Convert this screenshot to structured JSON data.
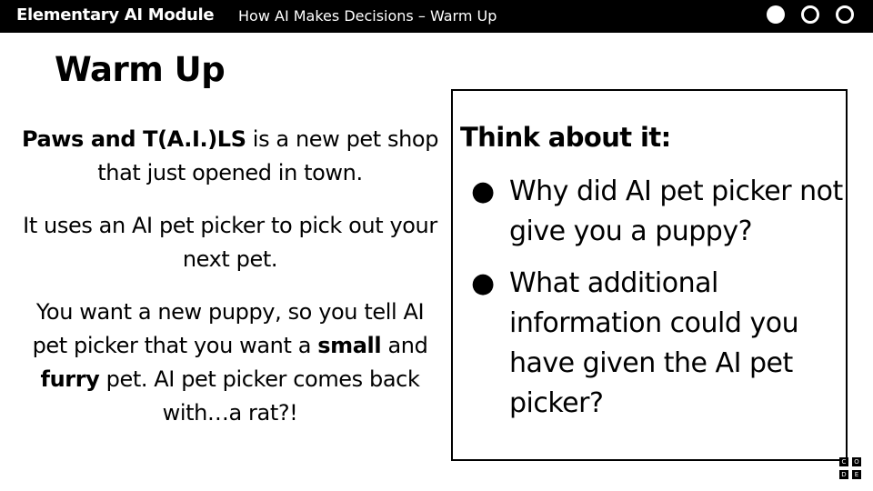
{
  "header": {
    "module_title": "Elementary AI Module",
    "lesson_title": "How AI Makes Decisions – Warm Up",
    "progress_dots": [
      "filled",
      "empty",
      "empty"
    ]
  },
  "slide": {
    "heading": "Warm Up",
    "paragraphs": {
      "p1_bold": "Paws and T(A.I.)LS",
      "p1_rest": " is a new pet shop that just opened in town.",
      "p2": "It uses an AI pet picker to pick out your next pet.",
      "p3_a": "You want a new puppy, so you tell AI pet picker that you want a ",
      "p3_bold1": "small",
      "p3_b": " and ",
      "p3_bold2": "furry",
      "p3_c": " pet. AI pet picker comes back with…a rat?!"
    },
    "think_box": {
      "title": "Think about it:",
      "bullet": "●",
      "questions": [
        "Why did AI pet picker not give you a puppy?",
        "What additional information could you have given the AI pet picker?"
      ]
    }
  },
  "logo": {
    "letters": [
      "C",
      "O",
      "D",
      "E"
    ]
  }
}
